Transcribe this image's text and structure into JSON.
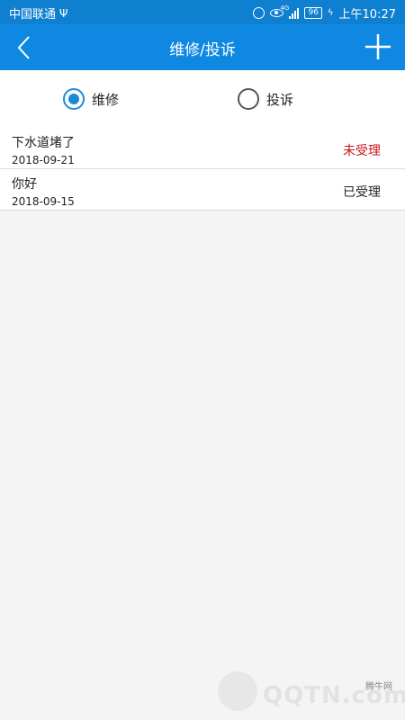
{
  "status_bar": {
    "carrier": "中国联通",
    "network": "4G",
    "battery": "96",
    "time": "上午10:27"
  },
  "nav": {
    "title": "维修/投诉"
  },
  "filter": {
    "options": [
      {
        "label": "维修",
        "selected": true
      },
      {
        "label": "投诉",
        "selected": false
      }
    ]
  },
  "records": [
    {
      "title": "下水道堵了",
      "date": "2018-09-21",
      "status": "未受理",
      "status_color": "#c8161d"
    },
    {
      "title": "你好",
      "date": "2018-09-15",
      "status": "已受理",
      "status_color": "#222222"
    }
  ],
  "watermark": {
    "site_cn": "腾牛网",
    "brand": "QQTN.com"
  },
  "colors": {
    "header": "#0f88e2",
    "status_bar": "#0f7fd0",
    "accent": "#1a8ad8"
  }
}
